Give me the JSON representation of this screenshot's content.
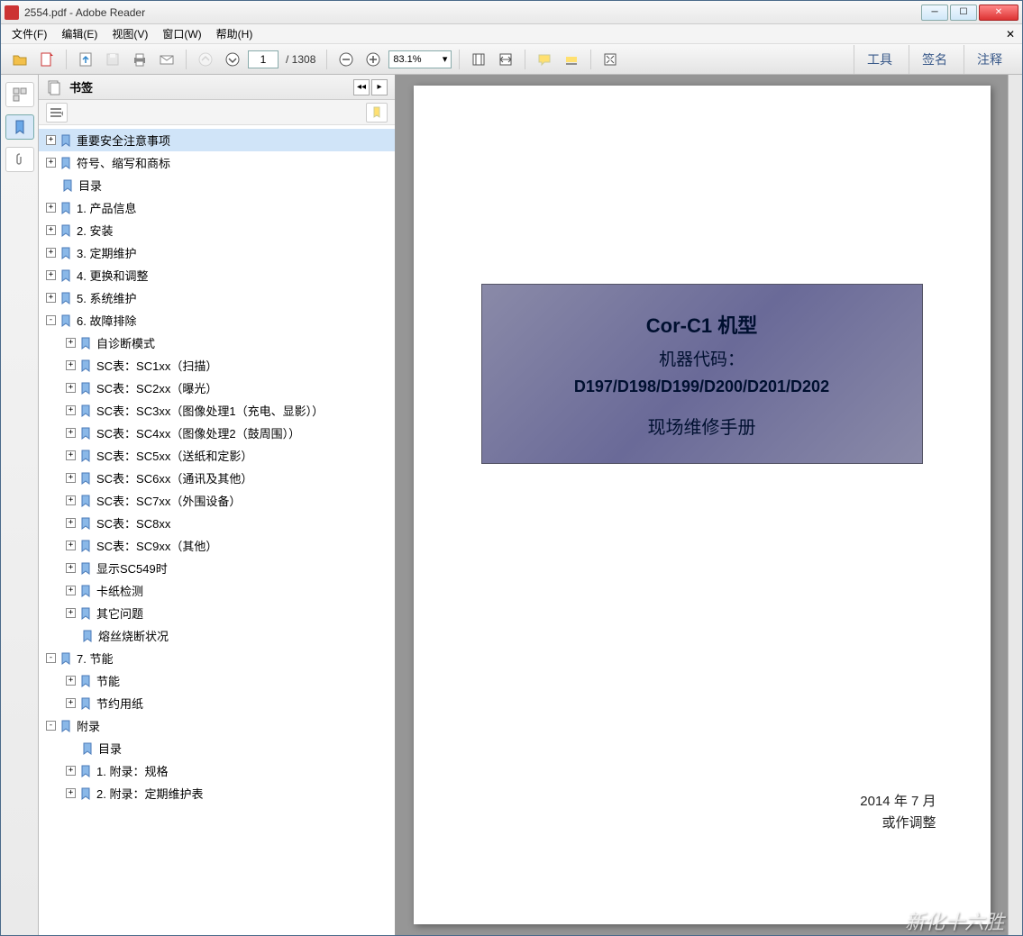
{
  "window": {
    "title": "2554.pdf - Adobe Reader"
  },
  "menu": {
    "items": [
      "文件(F)",
      "编辑(E)",
      "视图(V)",
      "窗口(W)",
      "帮助(H)"
    ]
  },
  "toolbar": {
    "page_current": "1",
    "page_total": "/ 1308",
    "zoom": "83.1%",
    "right_buttons": [
      "工具",
      "签名",
      "注释"
    ]
  },
  "sidebar": {
    "header": "书签",
    "tree": [
      {
        "label": "重要安全注意事项",
        "depth": 0,
        "exp": "+",
        "selected": true
      },
      {
        "label": "符号、缩写和商标",
        "depth": 0,
        "exp": "+"
      },
      {
        "label": "目录",
        "depth": 0,
        "exp": ""
      },
      {
        "label": "1. 产品信息",
        "depth": 0,
        "exp": "+"
      },
      {
        "label": "2. 安装",
        "depth": 0,
        "exp": "+"
      },
      {
        "label": "3. 定期维护",
        "depth": 0,
        "exp": "+"
      },
      {
        "label": "4. 更换和调整",
        "depth": 0,
        "exp": "+"
      },
      {
        "label": "5. 系统维护",
        "depth": 0,
        "exp": "+"
      },
      {
        "label": "6. 故障排除",
        "depth": 0,
        "exp": "-"
      },
      {
        "label": "自诊断模式",
        "depth": 1,
        "exp": "+"
      },
      {
        "label": "SC表：SC1xx（扫描）",
        "depth": 1,
        "exp": "+"
      },
      {
        "label": "SC表：SC2xx（曝光）",
        "depth": 1,
        "exp": "+"
      },
      {
        "label": "SC表：SC3xx（图像处理1（充电、显影））",
        "depth": 1,
        "exp": "+"
      },
      {
        "label": "SC表：SC4xx（图像处理2（鼓周围））",
        "depth": 1,
        "exp": "+"
      },
      {
        "label": "SC表：SC5xx（送纸和定影）",
        "depth": 1,
        "exp": "+"
      },
      {
        "label": "SC表：SC6xx（通讯及其他）",
        "depth": 1,
        "exp": "+"
      },
      {
        "label": "SC表：SC7xx（外围设备）",
        "depth": 1,
        "exp": "+"
      },
      {
        "label": "SC表：SC8xx",
        "depth": 1,
        "exp": "+"
      },
      {
        "label": "SC表：SC9xx（其他）",
        "depth": 1,
        "exp": "+"
      },
      {
        "label": "显示SC549时",
        "depth": 1,
        "exp": "+"
      },
      {
        "label": "卡纸检测",
        "depth": 1,
        "exp": "+"
      },
      {
        "label": "其它问题",
        "depth": 1,
        "exp": "+"
      },
      {
        "label": "熔丝烧断状况",
        "depth": 1,
        "exp": ""
      },
      {
        "label": "7. 节能",
        "depth": 0,
        "exp": "-"
      },
      {
        "label": "节能",
        "depth": 1,
        "exp": "+"
      },
      {
        "label": "节约用纸",
        "depth": 1,
        "exp": "+"
      },
      {
        "label": "附录",
        "depth": 0,
        "exp": "-"
      },
      {
        "label": "目录",
        "depth": 1,
        "exp": ""
      },
      {
        "label": "1. 附录：规格",
        "depth": 1,
        "exp": "+"
      },
      {
        "label": "2. 附录：定期维护表",
        "depth": 1,
        "exp": "+"
      }
    ]
  },
  "cover": {
    "line1a": "Cor-C1",
    "line1b": " 机型",
    "line2": "机器代码：",
    "line3": "D197/D198/D199/D200/D201/D202",
    "line4": "现场维修手册",
    "date": "2014 年 7 月",
    "note": "或作调整"
  },
  "watermark": "新化十六胜"
}
